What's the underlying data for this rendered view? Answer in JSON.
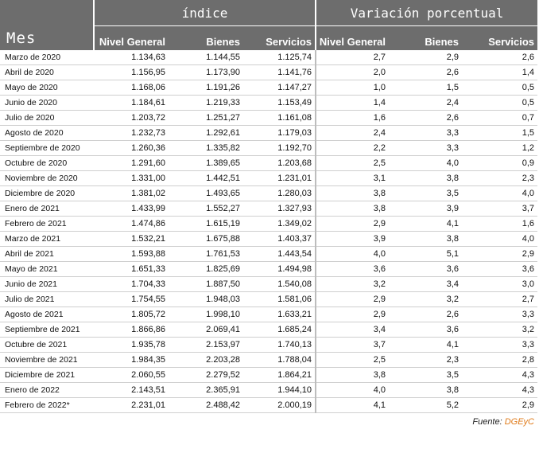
{
  "header": {
    "mes_label": "Mes",
    "group_indice": "índice",
    "group_variacion": "Variación porcentual",
    "columns": [
      "Nivel General",
      "Bienes",
      "Servicios",
      "Nivel General",
      "Bienes",
      "Servicios"
    ]
  },
  "rows": [
    [
      "Marzo de 2020",
      "1.134,63",
      "1.144,55",
      "1.125,74",
      "2,7",
      "2,9",
      "2,6"
    ],
    [
      "Abril de 2020",
      "1.156,95",
      "1.173,90",
      "1.141,76",
      "2,0",
      "2,6",
      "1,4"
    ],
    [
      "Mayo de 2020",
      "1.168,06",
      "1.191,26",
      "1.147,27",
      "1,0",
      "1,5",
      "0,5"
    ],
    [
      "Junio de 2020",
      "1.184,61",
      "1.219,33",
      "1.153,49",
      "1,4",
      "2,4",
      "0,5"
    ],
    [
      "Julio de 2020",
      "1.203,72",
      "1.251,27",
      "1.161,08",
      "1,6",
      "2,6",
      "0,7"
    ],
    [
      "Agosto de 2020",
      "1.232,73",
      "1.292,61",
      "1.179,03",
      "2,4",
      "3,3",
      "1,5"
    ],
    [
      "Septiembre de 2020",
      "1.260,36",
      "1.335,82",
      "1.192,70",
      "2,2",
      "3,3",
      "1,2"
    ],
    [
      "Octubre de 2020",
      "1.291,60",
      "1.389,65",
      "1.203,68",
      "2,5",
      "4,0",
      "0,9"
    ],
    [
      "Noviembre de 2020",
      "1.331,00",
      "1.442,51",
      "1.231,01",
      "3,1",
      "3,8",
      "2,3"
    ],
    [
      "Diciembre de 2020",
      "1.381,02",
      "1.493,65",
      "1.280,03",
      "3,8",
      "3,5",
      "4,0"
    ],
    [
      "Enero de 2021",
      "1.433,99",
      "1.552,27",
      "1.327,93",
      "3,8",
      "3,9",
      "3,7"
    ],
    [
      "Febrero de 2021",
      "1.474,86",
      "1.615,19",
      "1.349,02",
      "2,9",
      "4,1",
      "1,6"
    ],
    [
      "Marzo de 2021",
      "1.532,21",
      "1.675,88",
      "1.403,37",
      "3,9",
      "3,8",
      "4,0"
    ],
    [
      "Abril de 2021",
      "1.593,88",
      "1.761,53",
      "1.443,54",
      "4,0",
      "5,1",
      "2,9"
    ],
    [
      "Mayo de 2021",
      "1.651,33",
      "1.825,69",
      "1.494,98",
      "3,6",
      "3,6",
      "3,6"
    ],
    [
      "Junio de 2021",
      "1.704,33",
      "1.887,50",
      "1.540,08",
      "3,2",
      "3,4",
      "3,0"
    ],
    [
      "Julio de 2021",
      "1.754,55",
      "1.948,03",
      "1.581,06",
      "2,9",
      "3,2",
      "2,7"
    ],
    [
      "Agosto de 2021",
      "1.805,72",
      "1.998,10",
      "1.633,21",
      "2,9",
      "2,6",
      "3,3"
    ],
    [
      "Septiembre de 2021",
      "1.866,86",
      "2.069,41",
      "1.685,24",
      "3,4",
      "3,6",
      "3,2"
    ],
    [
      "Octubre de 2021",
      "1.935,78",
      "2.153,97",
      "1.740,13",
      "3,7",
      "4,1",
      "3,3"
    ],
    [
      "Noviembre de 2021",
      "1.984,35",
      "2.203,28",
      "1.788,04",
      "2,5",
      "2,3",
      "2,8"
    ],
    [
      "Diciembre de 2021",
      "2.060,55",
      "2.279,52",
      "1.864,21",
      "3,8",
      "3,5",
      "4,3"
    ],
    [
      "Enero de 2022",
      "2.143,51",
      "2.365,91",
      "1.944,10",
      "4,0",
      "3,8",
      "4,3"
    ],
    [
      "Febrero de 2022*",
      "2.231,01",
      "2.488,42",
      "2.000,19",
      "4,1",
      "5,2",
      "2,9"
    ]
  ],
  "footer": {
    "source_label": "Fuente: ",
    "source_name": "DGEyC"
  },
  "colors": {
    "header_bg": "#6d6d6d",
    "brand_orange": "#e07b1a"
  }
}
